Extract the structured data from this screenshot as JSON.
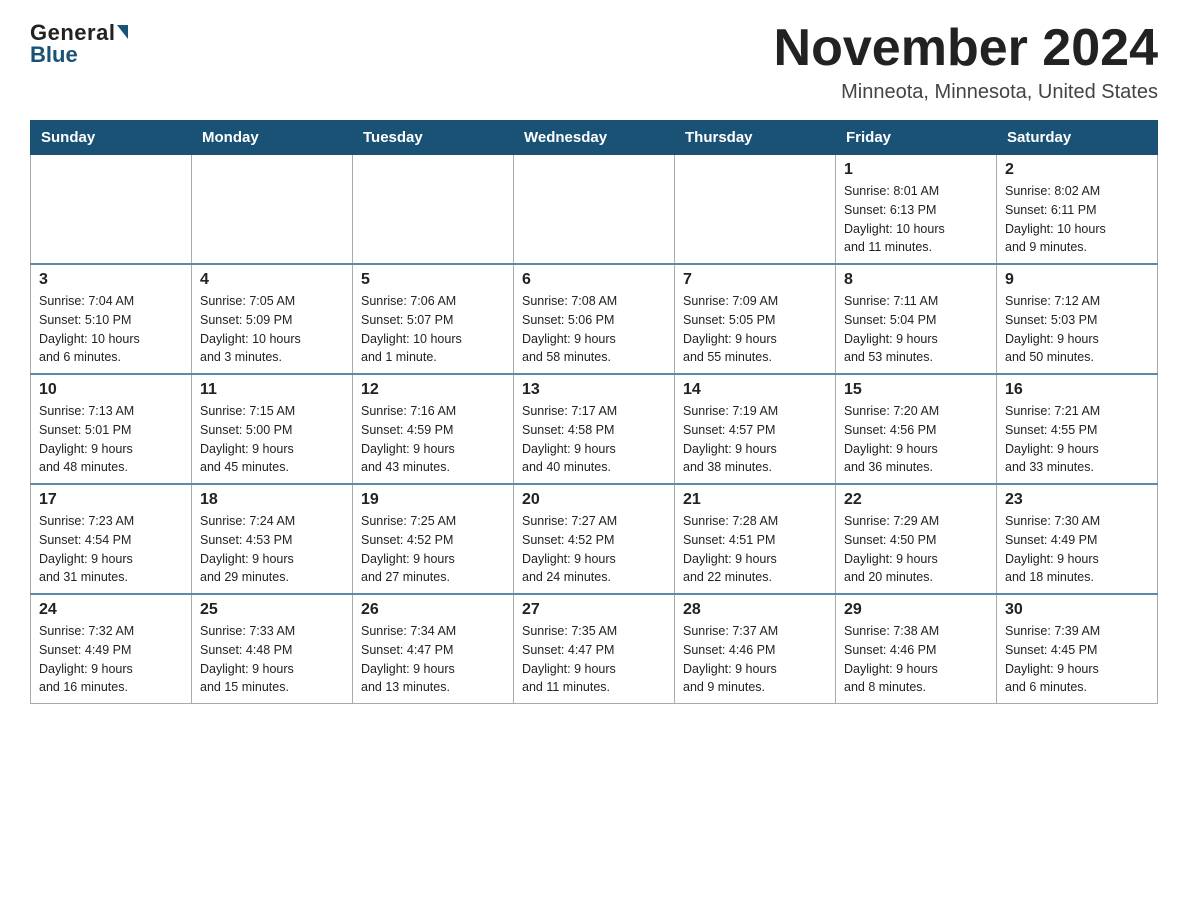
{
  "header": {
    "logo_top": "General",
    "logo_bottom": "Blue",
    "month_title": "November 2024",
    "location": "Minneota, Minnesota, United States"
  },
  "days_of_week": [
    "Sunday",
    "Monday",
    "Tuesday",
    "Wednesday",
    "Thursday",
    "Friday",
    "Saturday"
  ],
  "weeks": [
    [
      {
        "day": "",
        "info": ""
      },
      {
        "day": "",
        "info": ""
      },
      {
        "day": "",
        "info": ""
      },
      {
        "day": "",
        "info": ""
      },
      {
        "day": "",
        "info": ""
      },
      {
        "day": "1",
        "info": "Sunrise: 8:01 AM\nSunset: 6:13 PM\nDaylight: 10 hours\nand 11 minutes."
      },
      {
        "day": "2",
        "info": "Sunrise: 8:02 AM\nSunset: 6:11 PM\nDaylight: 10 hours\nand 9 minutes."
      }
    ],
    [
      {
        "day": "3",
        "info": "Sunrise: 7:04 AM\nSunset: 5:10 PM\nDaylight: 10 hours\nand 6 minutes."
      },
      {
        "day": "4",
        "info": "Sunrise: 7:05 AM\nSunset: 5:09 PM\nDaylight: 10 hours\nand 3 minutes."
      },
      {
        "day": "5",
        "info": "Sunrise: 7:06 AM\nSunset: 5:07 PM\nDaylight: 10 hours\nand 1 minute."
      },
      {
        "day": "6",
        "info": "Sunrise: 7:08 AM\nSunset: 5:06 PM\nDaylight: 9 hours\nand 58 minutes."
      },
      {
        "day": "7",
        "info": "Sunrise: 7:09 AM\nSunset: 5:05 PM\nDaylight: 9 hours\nand 55 minutes."
      },
      {
        "day": "8",
        "info": "Sunrise: 7:11 AM\nSunset: 5:04 PM\nDaylight: 9 hours\nand 53 minutes."
      },
      {
        "day": "9",
        "info": "Sunrise: 7:12 AM\nSunset: 5:03 PM\nDaylight: 9 hours\nand 50 minutes."
      }
    ],
    [
      {
        "day": "10",
        "info": "Sunrise: 7:13 AM\nSunset: 5:01 PM\nDaylight: 9 hours\nand 48 minutes."
      },
      {
        "day": "11",
        "info": "Sunrise: 7:15 AM\nSunset: 5:00 PM\nDaylight: 9 hours\nand 45 minutes."
      },
      {
        "day": "12",
        "info": "Sunrise: 7:16 AM\nSunset: 4:59 PM\nDaylight: 9 hours\nand 43 minutes."
      },
      {
        "day": "13",
        "info": "Sunrise: 7:17 AM\nSunset: 4:58 PM\nDaylight: 9 hours\nand 40 minutes."
      },
      {
        "day": "14",
        "info": "Sunrise: 7:19 AM\nSunset: 4:57 PM\nDaylight: 9 hours\nand 38 minutes."
      },
      {
        "day": "15",
        "info": "Sunrise: 7:20 AM\nSunset: 4:56 PM\nDaylight: 9 hours\nand 36 minutes."
      },
      {
        "day": "16",
        "info": "Sunrise: 7:21 AM\nSunset: 4:55 PM\nDaylight: 9 hours\nand 33 minutes."
      }
    ],
    [
      {
        "day": "17",
        "info": "Sunrise: 7:23 AM\nSunset: 4:54 PM\nDaylight: 9 hours\nand 31 minutes."
      },
      {
        "day": "18",
        "info": "Sunrise: 7:24 AM\nSunset: 4:53 PM\nDaylight: 9 hours\nand 29 minutes."
      },
      {
        "day": "19",
        "info": "Sunrise: 7:25 AM\nSunset: 4:52 PM\nDaylight: 9 hours\nand 27 minutes."
      },
      {
        "day": "20",
        "info": "Sunrise: 7:27 AM\nSunset: 4:52 PM\nDaylight: 9 hours\nand 24 minutes."
      },
      {
        "day": "21",
        "info": "Sunrise: 7:28 AM\nSunset: 4:51 PM\nDaylight: 9 hours\nand 22 minutes."
      },
      {
        "day": "22",
        "info": "Sunrise: 7:29 AM\nSunset: 4:50 PM\nDaylight: 9 hours\nand 20 minutes."
      },
      {
        "day": "23",
        "info": "Sunrise: 7:30 AM\nSunset: 4:49 PM\nDaylight: 9 hours\nand 18 minutes."
      }
    ],
    [
      {
        "day": "24",
        "info": "Sunrise: 7:32 AM\nSunset: 4:49 PM\nDaylight: 9 hours\nand 16 minutes."
      },
      {
        "day": "25",
        "info": "Sunrise: 7:33 AM\nSunset: 4:48 PM\nDaylight: 9 hours\nand 15 minutes."
      },
      {
        "day": "26",
        "info": "Sunrise: 7:34 AM\nSunset: 4:47 PM\nDaylight: 9 hours\nand 13 minutes."
      },
      {
        "day": "27",
        "info": "Sunrise: 7:35 AM\nSunset: 4:47 PM\nDaylight: 9 hours\nand 11 minutes."
      },
      {
        "day": "28",
        "info": "Sunrise: 7:37 AM\nSunset: 4:46 PM\nDaylight: 9 hours\nand 9 minutes."
      },
      {
        "day": "29",
        "info": "Sunrise: 7:38 AM\nSunset: 4:46 PM\nDaylight: 9 hours\nand 8 minutes."
      },
      {
        "day": "30",
        "info": "Sunrise: 7:39 AM\nSunset: 4:45 PM\nDaylight: 9 hours\nand 6 minutes."
      }
    ]
  ]
}
